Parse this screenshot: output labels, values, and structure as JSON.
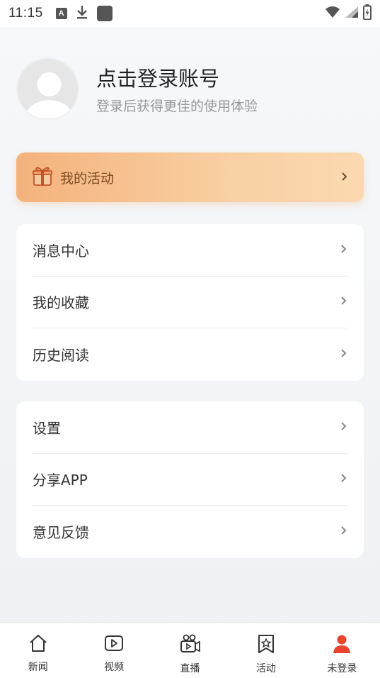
{
  "status_bar": {
    "time": "11:15",
    "a_icon": "A"
  },
  "header": {
    "title": "点击登录账号",
    "subtitle": "登录后获得更佳的使用体验"
  },
  "activity": {
    "label": "我的活动",
    "accent": "#f4b27c"
  },
  "group1": [
    {
      "label": "消息中心"
    },
    {
      "label": "我的收藏"
    },
    {
      "label": "历史阅读"
    }
  ],
  "group2": [
    {
      "label": "设置"
    },
    {
      "label": "分享APP"
    },
    {
      "label": "意见反馈"
    }
  ],
  "nav": [
    {
      "label": "新闻",
      "icon": "home-icon"
    },
    {
      "label": "视频",
      "icon": "video-icon"
    },
    {
      "label": "直播",
      "icon": "live-camera-icon"
    },
    {
      "label": "活动",
      "icon": "activity-star-icon"
    },
    {
      "label": "未登录",
      "icon": "user-icon",
      "active": true
    }
  ],
  "colors": {
    "active_user": "#e8442e"
  }
}
